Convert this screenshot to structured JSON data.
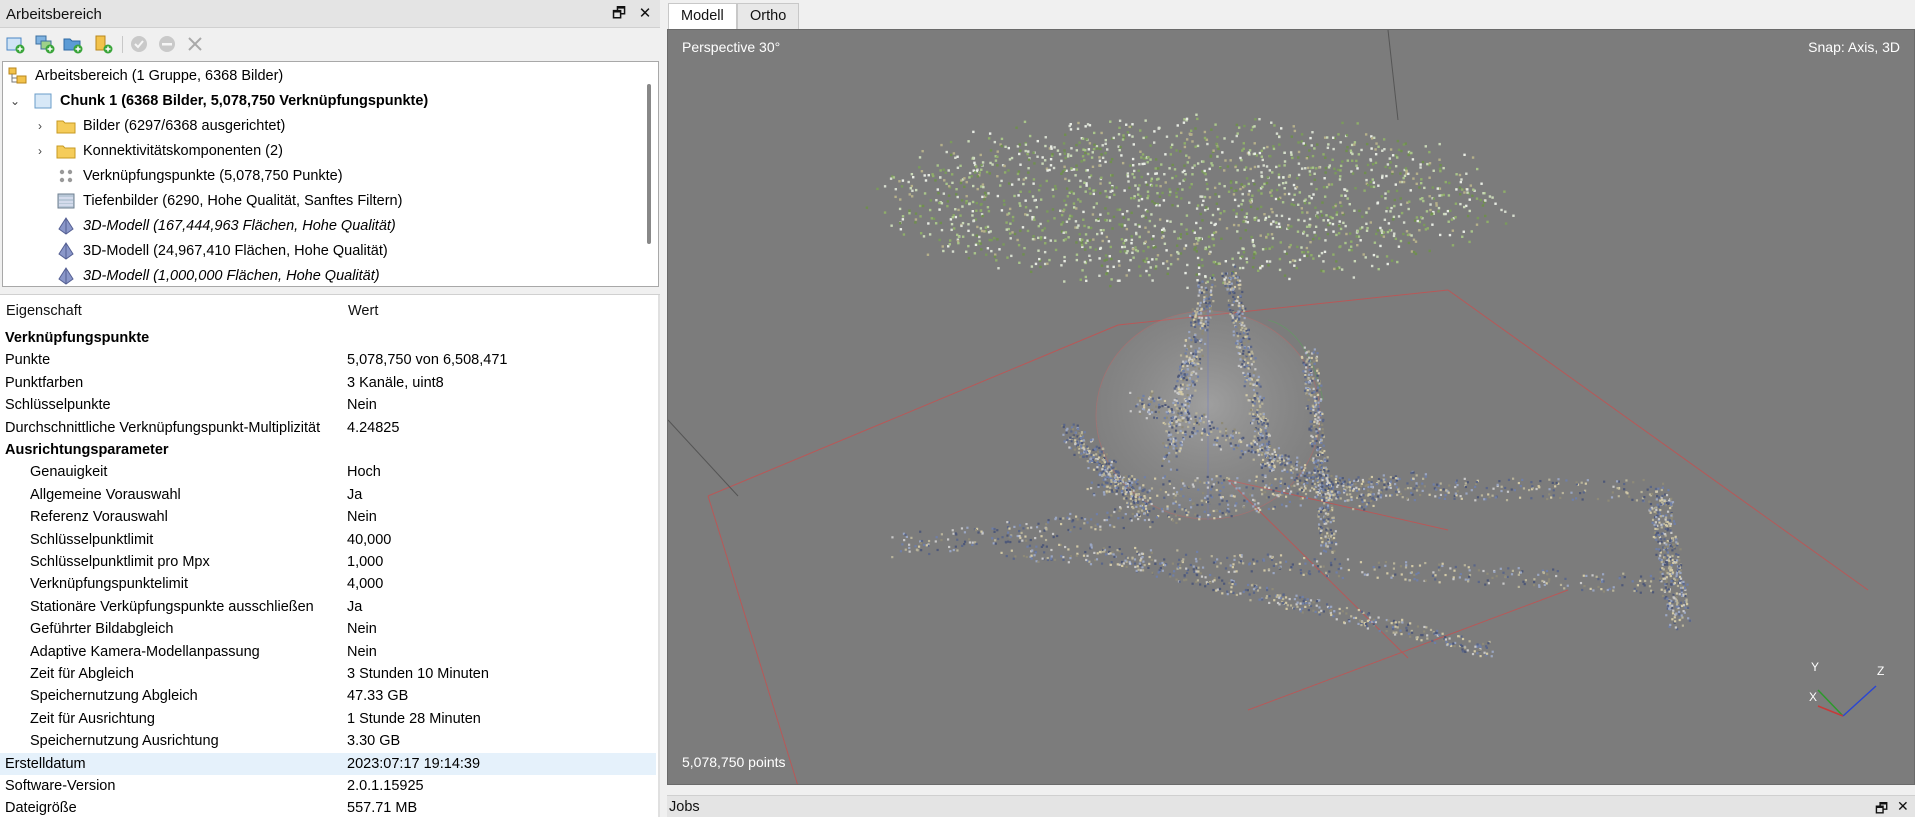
{
  "workspace": {
    "title": "Arbeitsbereich",
    "tree": [
      {
        "label": "Arbeitsbereich (1 Gruppe, 6368 Bilder)",
        "icon": "workspace-icon",
        "style": "normal"
      },
      {
        "label": "Chunk 1 (6368 Bilder, 5,078,750 Verknüpfungspunkte)",
        "icon": "chunk-icon",
        "style": "bold",
        "expanded": true
      },
      {
        "label": "Bilder (6297/6368 ausgerichtet)",
        "icon": "folder-icon",
        "style": "normal",
        "expanded": false
      },
      {
        "label": "Konnektivitätskomponenten (2)",
        "icon": "folder-icon",
        "style": "normal",
        "expanded": false
      },
      {
        "label": "Verknüpfungspunkte (5,078,750 Punkte)",
        "icon": "tie-points-icon",
        "style": "normal"
      },
      {
        "label": "Tiefenbilder (6290, Hohe Qualität, Sanftes Filtern)",
        "icon": "depth-maps-icon",
        "style": "normal"
      },
      {
        "label": "3D-Modell (167,444,963 Flächen, Hohe Qualität)",
        "icon": "model-icon",
        "style": "italic"
      },
      {
        "label": "3D-Modell (24,967,410 Flächen, Hohe Qualität)",
        "icon": "model-icon",
        "style": "normal"
      },
      {
        "label": "3D-Modell (1,000,000 Flächen, Hohe Qualität)",
        "icon": "model-icon",
        "style": "italic"
      }
    ]
  },
  "properties": {
    "header_property": "Eigenschaft",
    "header_value": "Wert",
    "rows": [
      {
        "key": "Verknüpfungspunkte",
        "value": "",
        "kind": "section"
      },
      {
        "key": "Punkte",
        "value": "5,078,750 von 6,508,471",
        "kind": "top"
      },
      {
        "key": "Punktfarben",
        "value": "3 Kanäle, uint8",
        "kind": "top"
      },
      {
        "key": "Schlüsselpunkte",
        "value": "Nein",
        "kind": "top"
      },
      {
        "key": "Durchschnittliche Verknüpfungspunkt-Multiplizität",
        "value": "4.24825",
        "kind": "top"
      },
      {
        "key": "Ausrichtungsparameter",
        "value": "",
        "kind": "section"
      },
      {
        "key": "Genauigkeit",
        "value": "Hoch",
        "kind": "sub"
      },
      {
        "key": "Allgemeine Vorauswahl",
        "value": "Ja",
        "kind": "sub"
      },
      {
        "key": "Referenz Vorauswahl",
        "value": "Nein",
        "kind": "sub"
      },
      {
        "key": "Schlüsselpunktlimit",
        "value": "40,000",
        "kind": "sub"
      },
      {
        "key": "Schlüsselpunktlimit pro Mpx",
        "value": "1,000",
        "kind": "sub"
      },
      {
        "key": "Verknüpfungspunktelimit",
        "value": "4,000",
        "kind": "sub"
      },
      {
        "key": "Stationäre Verküpfungspunkte ausschließen",
        "value": "Ja",
        "kind": "sub"
      },
      {
        "key": "Geführter Bildabgleich",
        "value": "Nein",
        "kind": "sub"
      },
      {
        "key": "Adaptive Kamera-Modellanpassung",
        "value": "Nein",
        "kind": "sub"
      },
      {
        "key": "Zeit für Abgleich",
        "value": "3 Stunden 10 Minuten",
        "kind": "sub"
      },
      {
        "key": "Speichernutzung Abgleich",
        "value": "47.33 GB",
        "kind": "sub"
      },
      {
        "key": "Zeit für Ausrichtung",
        "value": "1 Stunde 28 Minuten",
        "kind": "sub"
      },
      {
        "key": "Speichernutzung Ausrichtung",
        "value": "3.30 GB",
        "kind": "sub"
      },
      {
        "key": "Erstelldatum",
        "value": "2023:07:17 19:14:39",
        "kind": "top",
        "highlight": true
      },
      {
        "key": "Software-Version",
        "value": "2.0.1.15925",
        "kind": "top"
      },
      {
        "key": "Dateigröße",
        "value": "557.71 MB",
        "kind": "top"
      }
    ]
  },
  "tabs": [
    {
      "label": "Modell",
      "active": true
    },
    {
      "label": "Ortho",
      "active": false
    }
  ],
  "viewport": {
    "projection": "Perspective 30°",
    "snap": "Snap: Axis, 3D",
    "points": "5,078,750 points",
    "axes": {
      "x": "X",
      "y": "Y",
      "z": "Z"
    }
  },
  "jobs": {
    "title": "Jobs"
  }
}
